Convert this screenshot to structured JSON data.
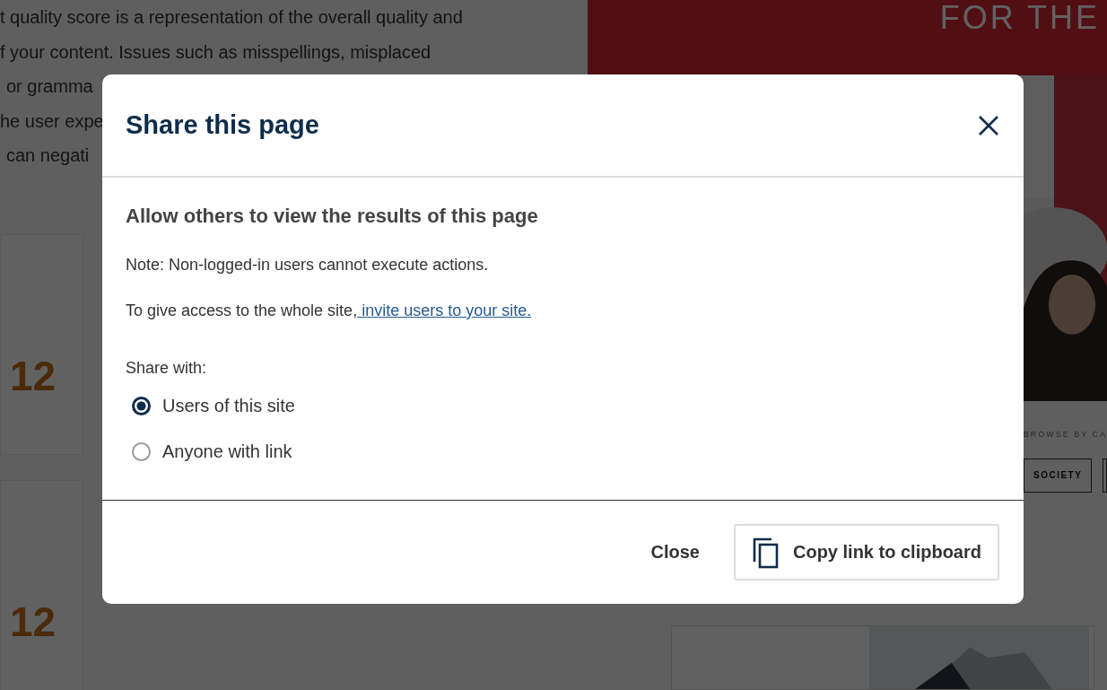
{
  "background": {
    "paragraph_lines": [
      "t quality score is a representation of the overall quality and",
      "f your content. Issues such as misspellings, misplaced",
      "or gramma",
      "he user expe",
      "can negati"
    ],
    "scores": [
      "12",
      "12"
    ],
    "banner_text": "FOR THE",
    "browse_label": "BROWSE BY CA",
    "category_tags": [
      "SOCIETY"
    ]
  },
  "dialog": {
    "title": "Share this page",
    "heading": "Allow others to view the results of this page",
    "note": "Note: Non-logged-in users cannot execute actions.",
    "access_text": "To give access to the whole site,",
    "access_link": " invite users to your site.",
    "share_label": "Share with:",
    "options": [
      {
        "label": "Users of this site",
        "selected": true
      },
      {
        "label": "Anyone with link",
        "selected": false
      }
    ],
    "buttons": [
      {
        "label": "Close",
        "kind": "text"
      },
      {
        "label": "Copy link to clipboard",
        "kind": "copy"
      }
    ]
  }
}
